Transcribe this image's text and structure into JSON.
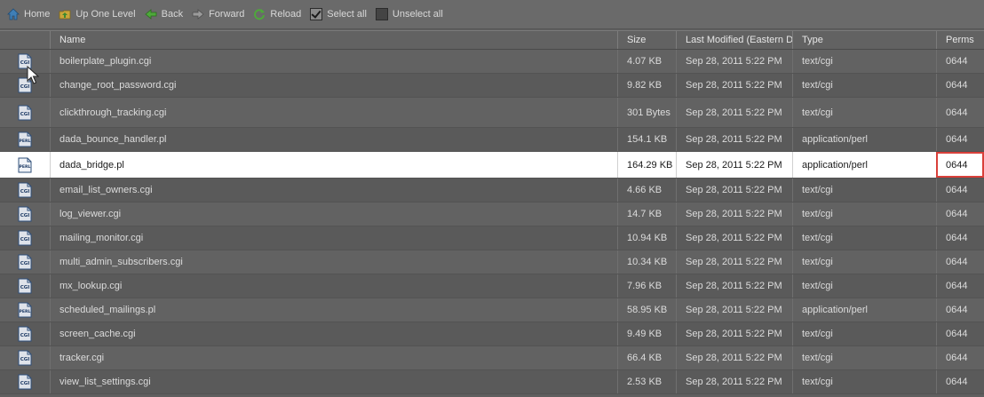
{
  "toolbar": {
    "home": "Home",
    "up": "Up One Level",
    "back": "Back",
    "forward": "Forward",
    "reload": "Reload",
    "select_all": "Select all",
    "unselect_all": "Unselect all"
  },
  "columns": {
    "name": "Name",
    "size": "Size",
    "modified": "Last Modified (Eastern Da",
    "type": "Type",
    "perms": "Perms"
  },
  "rows": [
    {
      "name": "boilerplate_plugin.cgi",
      "size": "4.07 KB",
      "modified": "Sep 28, 2011 5:22 PM",
      "type": "text/cgi",
      "perms": "0644",
      "icon": "cgi-file-icon"
    },
    {
      "name": "change_root_password.cgi",
      "size": "9.82 KB",
      "modified": "Sep 28, 2011 5:22 PM",
      "type": "text/cgi",
      "perms": "0644",
      "icon": "cgi-file-icon"
    },
    {
      "name": "clickthrough_tracking.cgi",
      "size": "301 Bytes",
      "modified": "Sep 28, 2011 5:22 PM",
      "type": "text/cgi",
      "perms": "0644",
      "icon": "cgi-file-icon"
    },
    {
      "name": "dada_bounce_handler.pl",
      "size": "154.1 KB",
      "modified": "Sep 28, 2011 5:22 PM",
      "type": "application/perl",
      "perms": "0644",
      "icon": "perl-file-icon"
    },
    {
      "name": "dada_bridge.pl",
      "size": "164.29 KB",
      "modified": "Sep 28, 2011 5:22 PM",
      "type": "application/perl",
      "perms": "0644",
      "icon": "perl-file-icon",
      "selected": true
    },
    {
      "name": "email_list_owners.cgi",
      "size": "4.66 KB",
      "modified": "Sep 28, 2011 5:22 PM",
      "type": "text/cgi",
      "perms": "0644",
      "icon": "cgi-file-icon"
    },
    {
      "name": "log_viewer.cgi",
      "size": "14.7 KB",
      "modified": "Sep 28, 2011 5:22 PM",
      "type": "text/cgi",
      "perms": "0644",
      "icon": "cgi-file-icon"
    },
    {
      "name": "mailing_monitor.cgi",
      "size": "10.94 KB",
      "modified": "Sep 28, 2011 5:22 PM",
      "type": "text/cgi",
      "perms": "0644",
      "icon": "cgi-file-icon"
    },
    {
      "name": "multi_admin_subscribers.cgi",
      "size": "10.34 KB",
      "modified": "Sep 28, 2011 5:22 PM",
      "type": "text/cgi",
      "perms": "0644",
      "icon": "cgi-file-icon"
    },
    {
      "name": "mx_lookup.cgi",
      "size": "7.96 KB",
      "modified": "Sep 28, 2011 5:22 PM",
      "type": "text/cgi",
      "perms": "0644",
      "icon": "cgi-file-icon"
    },
    {
      "name": "scheduled_mailings.pl",
      "size": "58.95 KB",
      "modified": "Sep 28, 2011 5:22 PM",
      "type": "application/perl",
      "perms": "0644",
      "icon": "perl-file-icon"
    },
    {
      "name": "screen_cache.cgi",
      "size": "9.49 KB",
      "modified": "Sep 28, 2011 5:22 PM",
      "type": "text/cgi",
      "perms": "0644",
      "icon": "cgi-file-icon"
    },
    {
      "name": "tracker.cgi",
      "size": "66.4 KB",
      "modified": "Sep 28, 2011 5:22 PM",
      "type": "text/cgi",
      "perms": "0644",
      "icon": "cgi-file-icon"
    },
    {
      "name": "view_list_settings.cgi",
      "size": "2.53 KB",
      "modified": "Sep 28, 2011 5:22 PM",
      "type": "text/cgi",
      "perms": "0644",
      "icon": "cgi-file-icon"
    }
  ],
  "icon_labels": {
    "cgi": "CGI",
    "perl": "PERL"
  },
  "colors": {
    "selected_row": "#ffffff",
    "perms_highlight": "#d9403a"
  }
}
